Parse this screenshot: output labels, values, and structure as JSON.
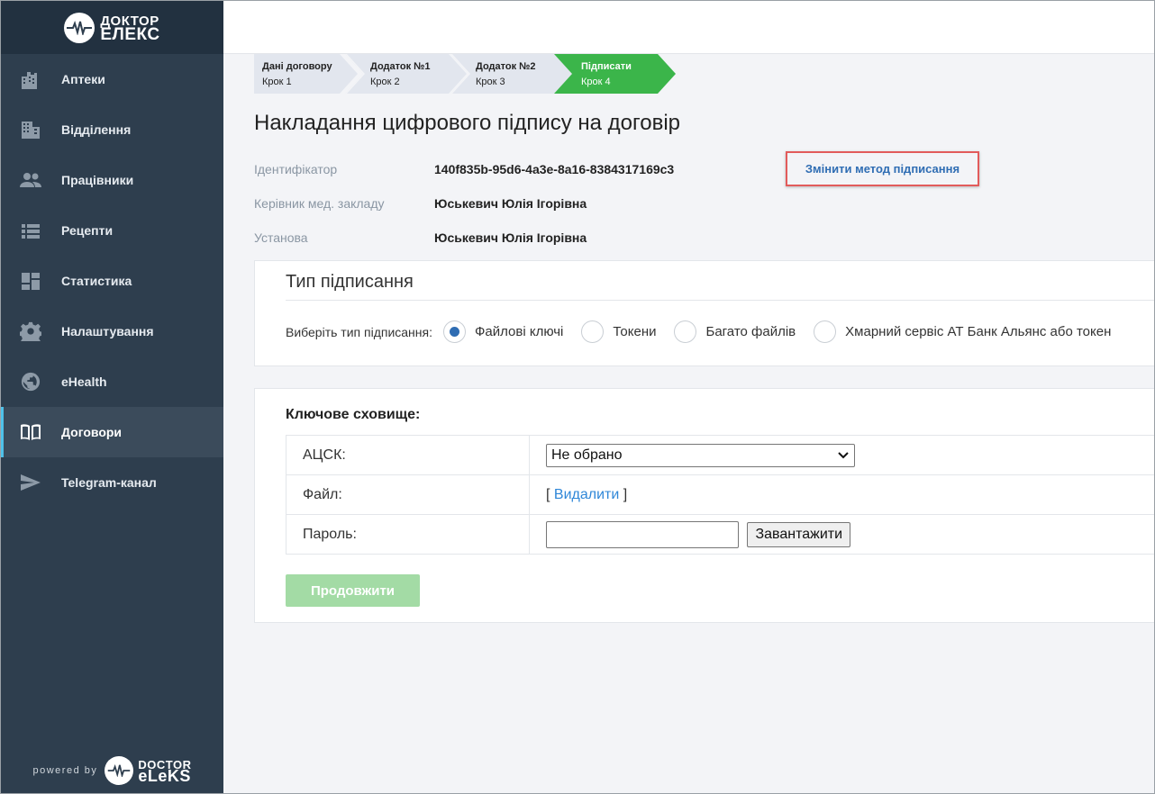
{
  "brand": {
    "logo_line1": "ДОКТОР",
    "logo_line2": "ЕЛЕКС",
    "powered_by": "powered by",
    "powered_line1": "DOCTOR",
    "powered_line2": "eLeKS"
  },
  "sidebar": {
    "items": [
      {
        "label": "Аптеки",
        "icon": "building-icon"
      },
      {
        "label": "Відділення",
        "icon": "office-icon"
      },
      {
        "label": "Працівники",
        "icon": "people-icon"
      },
      {
        "label": "Рецепти",
        "icon": "list-icon"
      },
      {
        "label": "Статистика",
        "icon": "dashboard-icon"
      },
      {
        "label": "Налаштування",
        "icon": "gear-icon"
      },
      {
        "label": "eHealth",
        "icon": "globe-icon"
      },
      {
        "label": "Договори",
        "icon": "book-icon",
        "active": true
      },
      {
        "label": "Telegram-канал",
        "icon": "send-icon"
      }
    ],
    "active_color": "#4fc1e9"
  },
  "steps": [
    {
      "title": "Дані договору",
      "sub": "Крок 1"
    },
    {
      "title": "Додаток №1",
      "sub": "Крок 2"
    },
    {
      "title": "Додаток №2",
      "sub": "Крок 3"
    },
    {
      "title": "Підписати",
      "sub": "Крок 4",
      "current": true
    }
  ],
  "page": {
    "title": "Накладання цифрового підпису на договір",
    "change_method": "Змінити метод підписання",
    "info": {
      "id_label": "Ідентифікатор",
      "id_value": "140f835b-95d6-4a3e-8a16-8384317169c3",
      "head_label": "Керівник мед. закладу",
      "head_value": "Юськевич Юлія Ігорівна",
      "org_label": "Установа",
      "org_value": "Юськевич Юлія Ігорівна"
    }
  },
  "sign_type": {
    "title": "Тип підписання",
    "prompt": "Виберіть тип підписання:",
    "options": [
      {
        "label": "Файлові ключі",
        "selected": true
      },
      {
        "label": "Токени",
        "selected": false
      },
      {
        "label": "Багато файлів",
        "selected": false
      },
      {
        "label": "Хмарний сервіс АТ Банк Альянс або токен",
        "selected": false
      }
    ]
  },
  "keystore": {
    "title": "Ключове сховище:",
    "acsk_label": "АЦСК:",
    "acsk_value": "Не обрано",
    "file_label": "Файл:",
    "file_open": "[",
    "file_delete": "Видалити",
    "file_close": "]",
    "password_label": "Пароль:",
    "password_value": "",
    "upload_label": "Завантажити",
    "continue_label": "Продовжити"
  },
  "colors": {
    "step_active": "#3bb54a",
    "step_inactive": "#e2e6ee",
    "continue_disabled": "#a3dba5",
    "link": "#2f6db3",
    "highlight": "#e25b5b"
  }
}
